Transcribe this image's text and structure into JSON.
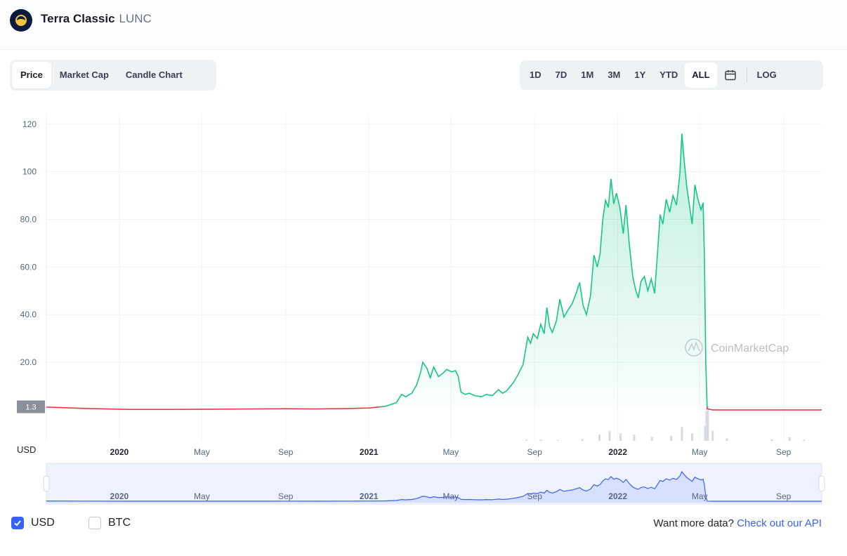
{
  "header": {
    "name": "Terra Classic",
    "symbol": "LUNC"
  },
  "tabs": [
    {
      "label": "Price",
      "active": true
    },
    {
      "label": "Market Cap",
      "active": false
    },
    {
      "label": "Candle Chart",
      "active": false
    }
  ],
  "ranges": [
    {
      "label": "1D",
      "active": false
    },
    {
      "label": "7D",
      "active": false
    },
    {
      "label": "1M",
      "active": false
    },
    {
      "label": "3M",
      "active": false
    },
    {
      "label": "1Y",
      "active": false
    },
    {
      "label": "YTD",
      "active": false
    },
    {
      "label": "ALL",
      "active": true
    }
  ],
  "range_calendar_icon": "calendar-icon",
  "range_log": "LOG",
  "currency_toggles": [
    {
      "label": "USD",
      "checked": true
    },
    {
      "label": "BTC",
      "checked": false
    }
  ],
  "api_prefix": "Want more data? ",
  "api_link": "Check out our API",
  "watermark": "CoinMarketCap",
  "colors": {
    "up": "#16c784",
    "down": "#ea3943",
    "accent": "#3861fb",
    "navigator": "#3861fb"
  },
  "chart_data": {
    "type": "line",
    "ylabel": "USD",
    "ylim": [
      -13,
      122
    ],
    "y_ticks": [
      {
        "label": "120",
        "value": 120
      },
      {
        "label": "100",
        "value": 100
      },
      {
        "label": "80.0",
        "value": 80
      },
      {
        "label": "60.0",
        "value": 60
      },
      {
        "label": "40.0",
        "value": 40
      },
      {
        "label": "20.0",
        "value": 20
      }
    ],
    "current_price_label": "1.3",
    "current_price": 1.3,
    "x_range": [
      "2019-09-16",
      "2022-10-27"
    ],
    "x_ticks": [
      {
        "label": "2020",
        "date": "2020-01-01"
      },
      {
        "label": "May",
        "date": "2020-05-01"
      },
      {
        "label": "Sep",
        "date": "2020-09-01"
      },
      {
        "label": "2021",
        "date": "2021-01-01"
      },
      {
        "label": "May",
        "date": "2021-05-01"
      },
      {
        "label": "Sep",
        "date": "2021-09-01"
      },
      {
        "label": "2022",
        "date": "2022-01-01"
      },
      {
        "label": "May",
        "date": "2022-05-01"
      },
      {
        "label": "Sep",
        "date": "2022-09-01"
      }
    ],
    "series": [
      {
        "points": [
          [
            "2019-09-16",
            1.2
          ],
          [
            "2019-11-15",
            0.6
          ],
          [
            "2020-01-15",
            0.2
          ],
          [
            "2020-03-15",
            0.2
          ],
          [
            "2020-05-15",
            0.3
          ],
          [
            "2020-07-15",
            0.4
          ],
          [
            "2020-09-01",
            0.5
          ],
          [
            "2020-10-15",
            0.4
          ],
          [
            "2020-12-01",
            0.6
          ],
          [
            "2021-01-01",
            0.8
          ],
          [
            "2021-01-25",
            1.5
          ],
          [
            "2021-02-10",
            3.0
          ],
          [
            "2021-02-18",
            6.5
          ],
          [
            "2021-02-24",
            5.5
          ],
          [
            "2021-03-05",
            7.0
          ],
          [
            "2021-03-12",
            10.5
          ],
          [
            "2021-03-18",
            16.0
          ],
          [
            "2021-03-21",
            20.0
          ],
          [
            "2021-03-27",
            17.5
          ],
          [
            "2021-04-01",
            13.5
          ],
          [
            "2021-04-06",
            18.0
          ],
          [
            "2021-04-13",
            14.0
          ],
          [
            "2021-04-20",
            15.5
          ],
          [
            "2021-04-25",
            17.0
          ],
          [
            "2021-05-02",
            16.0
          ],
          [
            "2021-05-08",
            16.5
          ],
          [
            "2021-05-12",
            14.0
          ],
          [
            "2021-05-16",
            7.5
          ],
          [
            "2021-05-22",
            6.5
          ],
          [
            "2021-05-28",
            7.0
          ],
          [
            "2021-06-05",
            6.0
          ],
          [
            "2021-06-15",
            5.5
          ],
          [
            "2021-06-22",
            6.5
          ],
          [
            "2021-07-01",
            6.0
          ],
          [
            "2021-07-10",
            8.5
          ],
          [
            "2021-07-16",
            7.0
          ],
          [
            "2021-07-22",
            8.0
          ],
          [
            "2021-08-01",
            11.5
          ],
          [
            "2021-08-08",
            15.0
          ],
          [
            "2021-08-15",
            19.0
          ],
          [
            "2021-08-22",
            30.5
          ],
          [
            "2021-08-26",
            28.0
          ],
          [
            "2021-08-30",
            32.0
          ],
          [
            "2021-09-05",
            30.0
          ],
          [
            "2021-09-10",
            36.0
          ],
          [
            "2021-09-15",
            32.0
          ],
          [
            "2021-09-19",
            43.0
          ],
          [
            "2021-09-23",
            35.0
          ],
          [
            "2021-09-27",
            32.5
          ],
          [
            "2021-10-03",
            37.5
          ],
          [
            "2021-10-08",
            46.5
          ],
          [
            "2021-10-14",
            39.0
          ],
          [
            "2021-10-20",
            42.0
          ],
          [
            "2021-10-26",
            44.5
          ],
          [
            "2021-11-01",
            49.0
          ],
          [
            "2021-11-06",
            53.5
          ],
          [
            "2021-11-11",
            44.0
          ],
          [
            "2021-11-16",
            40.0
          ],
          [
            "2021-11-22",
            48.0
          ],
          [
            "2021-11-27",
            65.0
          ],
          [
            "2021-12-02",
            60.0
          ],
          [
            "2021-12-06",
            65.5
          ],
          [
            "2021-12-10",
            80.0
          ],
          [
            "2021-12-14",
            88.0
          ],
          [
            "2021-12-18",
            85.0
          ],
          [
            "2021-12-22",
            97.0
          ],
          [
            "2021-12-26",
            86.5
          ],
          [
            "2021-12-30",
            91.0
          ],
          [
            "2022-01-04",
            85.0
          ],
          [
            "2022-01-09",
            74.0
          ],
          [
            "2022-01-13",
            86.0
          ],
          [
            "2022-01-18",
            69.0
          ],
          [
            "2022-01-23",
            56.0
          ],
          [
            "2022-01-27",
            50.5
          ],
          [
            "2022-01-31",
            47.0
          ],
          [
            "2022-02-04",
            54.0
          ],
          [
            "2022-02-09",
            56.0
          ],
          [
            "2022-02-14",
            50.0
          ],
          [
            "2022-02-19",
            55.0
          ],
          [
            "2022-02-24",
            49.0
          ],
          [
            "2022-02-28",
            65.0
          ],
          [
            "2022-03-04",
            82.0
          ],
          [
            "2022-03-08",
            78.0
          ],
          [
            "2022-03-13",
            88.5
          ],
          [
            "2022-03-18",
            83.0
          ],
          [
            "2022-03-23",
            90.0
          ],
          [
            "2022-03-28",
            86.0
          ],
          [
            "2022-04-02",
            99.0
          ],
          [
            "2022-04-05",
            116.0
          ],
          [
            "2022-04-08",
            105.5
          ],
          [
            "2022-04-12",
            94.0
          ],
          [
            "2022-04-16",
            86.0
          ],
          [
            "2022-04-20",
            78.0
          ],
          [
            "2022-04-24",
            94.5
          ],
          [
            "2022-04-28",
            89.0
          ],
          [
            "2022-05-03",
            84.0
          ],
          [
            "2022-05-06",
            87.0
          ],
          [
            "2022-05-08",
            64.0
          ],
          [
            "2022-05-10",
            20.0
          ],
          [
            "2022-05-12",
            0.5
          ],
          [
            "2022-05-20",
            0.0001
          ],
          [
            "2022-07-01",
            0.0001
          ],
          [
            "2022-09-01",
            0.0002
          ],
          [
            "2022-10-27",
            0.0002
          ]
        ]
      }
    ],
    "volume": [
      [
        "2021-08-20",
        0.5
      ],
      [
        "2021-09-10",
        0.6
      ],
      [
        "2021-10-05",
        0.4
      ],
      [
        "2021-11-10",
        0.7
      ],
      [
        "2021-12-05",
        2.5
      ],
      [
        "2021-12-20",
        4.0
      ],
      [
        "2022-01-05",
        3.0
      ],
      [
        "2022-01-25",
        2.5
      ],
      [
        "2022-02-20",
        1.5
      ],
      [
        "2022-03-20",
        2.0
      ],
      [
        "2022-04-05",
        5.5
      ],
      [
        "2022-04-20",
        3.0
      ],
      [
        "2022-05-09",
        6.0
      ],
      [
        "2022-05-11",
        12.0
      ],
      [
        "2022-05-13",
        14.0
      ],
      [
        "2022-05-20",
        4.0
      ],
      [
        "2022-06-10",
        1.0
      ],
      [
        "2022-08-15",
        0.6
      ],
      [
        "2022-09-10",
        1.5
      ],
      [
        "2022-10-01",
        0.5
      ]
    ],
    "navigator": {
      "x_ticks": [
        "2020",
        "May",
        "Sep",
        "2021",
        "May",
        "Sep",
        "2022",
        "May",
        "Sep"
      ]
    }
  }
}
